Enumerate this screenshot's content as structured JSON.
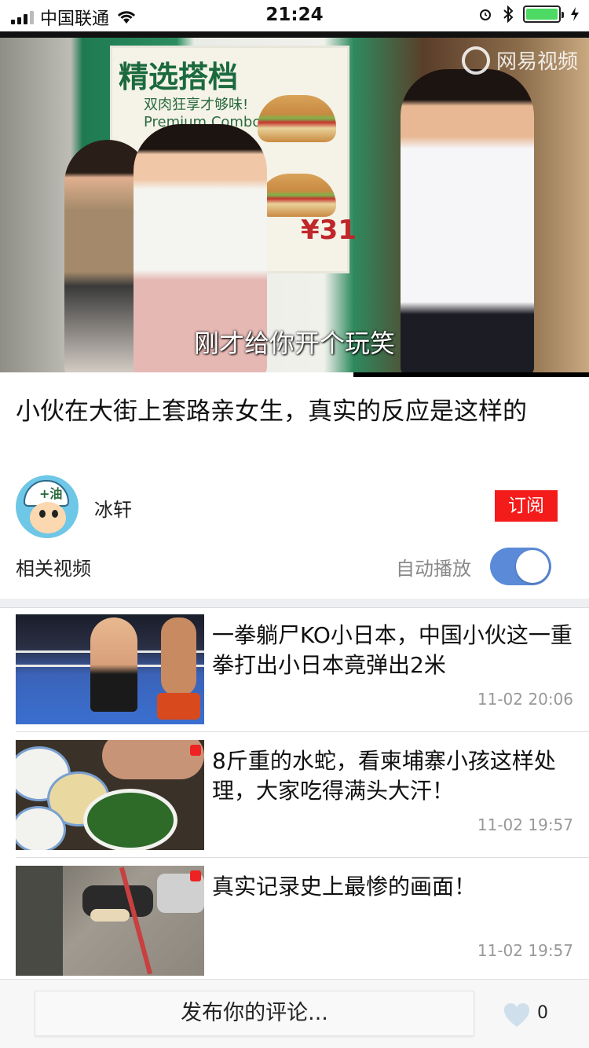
{
  "status_bar": {
    "carrier": "中国联通",
    "time": "21:24"
  },
  "video": {
    "watermark": "网易视频",
    "subtitle": "刚才给你开个玩笑",
    "poster_title": "精选搭档",
    "poster_sub_1": "双肉狂享才够味!",
    "poster_sub_2": "Premium Combos",
    "poster_price": "¥31",
    "progress": 0.6
  },
  "title": "小伙在大街上套路亲女生，真实的反应是这样的",
  "author": {
    "name": "冰轩",
    "subscribe_label": "订阅"
  },
  "related": {
    "label": "相关视频",
    "autoplay_label": "自动播放",
    "autoplay_on": true
  },
  "items": [
    {
      "title": "一拳躺尸KO小日本，中国小伙这一重拳打出小日本竟弹出2米",
      "time": "11-02 20:06"
    },
    {
      "title": "8斤重的水蛇，看柬埔寨小孩这样处理，大家吃得满头大汗！",
      "time": "11-02 19:57"
    },
    {
      "title": "真实记录史上最惨的画面！",
      "time": "11-02 19:57"
    }
  ],
  "bottom": {
    "comment_placeholder": "发布你的评论...",
    "like_count": "0"
  },
  "colors": {
    "subscribe": "#f41b1b",
    "toggle": "#5b8bd8",
    "battery": "#4cd964"
  }
}
